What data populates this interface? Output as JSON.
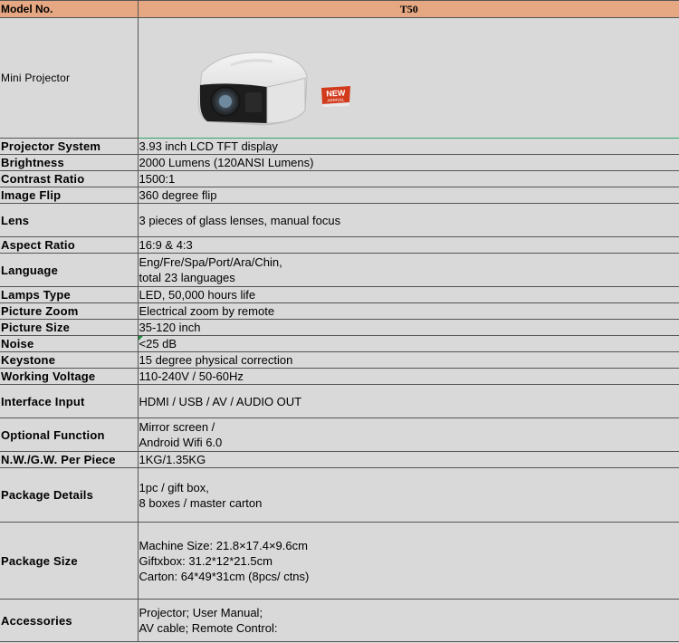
{
  "header": {
    "label": "Model No.",
    "model": "T50"
  },
  "image_row": {
    "label": "Mini Projector",
    "badge_text_1": "NEW",
    "badge_text_2": "ARRIVAL"
  },
  "specs": [
    {
      "label": "Projector System",
      "value": "3.93 inch LCD TFT display"
    },
    {
      "label": "Brightness",
      "value": "2000 Lumens (120ANSI Lumens)"
    },
    {
      "label": "Contrast Ratio",
      "value": "1500:1"
    },
    {
      "label": "Image Flip",
      "value": "360 degree flip"
    },
    {
      "label": "Lens",
      "value": "3 pieces of glass lenses, manual focus"
    },
    {
      "label": "Aspect Ratio",
      "value": "16:9 & 4:3"
    },
    {
      "label": "Language",
      "value": "Eng/Fre/Spa/Port/Ara/Chin,\ntotal 23 languages"
    },
    {
      "label": "Lamps Type",
      "value": "LED, 50,000 hours life"
    },
    {
      "label": "Picture Zoom",
      "value": "Electrical zoom by remote"
    },
    {
      "label": "Picture Size",
      "value": "35-120 inch"
    },
    {
      "label": "Noise",
      "value": "<25 dB"
    },
    {
      "label": "Keystone",
      "value": "15 degree physical correction"
    },
    {
      "label": "Working Voltage",
      "value": "110-240V / 50-60Hz"
    },
    {
      "label": "Interface Input",
      "value": "HDMI / USB / AV / AUDIO OUT"
    },
    {
      "label": "Optional Function",
      "value": "Mirror screen /\nAndroid Wifi 6.0"
    },
    {
      "label": "N.W./G.W. Per Piece",
      "value": "1KG/1.35KG"
    },
    {
      "label": "Package Details",
      "value": "1pc / gift box,\n8 boxes / master carton"
    },
    {
      "label": "Package Size",
      "value": "Machine Size: 21.8×17.4×9.6cm\nGiftxbox: 31.2*12*21.5cm\nCarton: 64*49*31cm  (8pcs/ ctns)"
    },
    {
      "label": "Accessories",
      "value": "Projector; User Manual;\nAV cable; Remote Control:"
    }
  ]
}
